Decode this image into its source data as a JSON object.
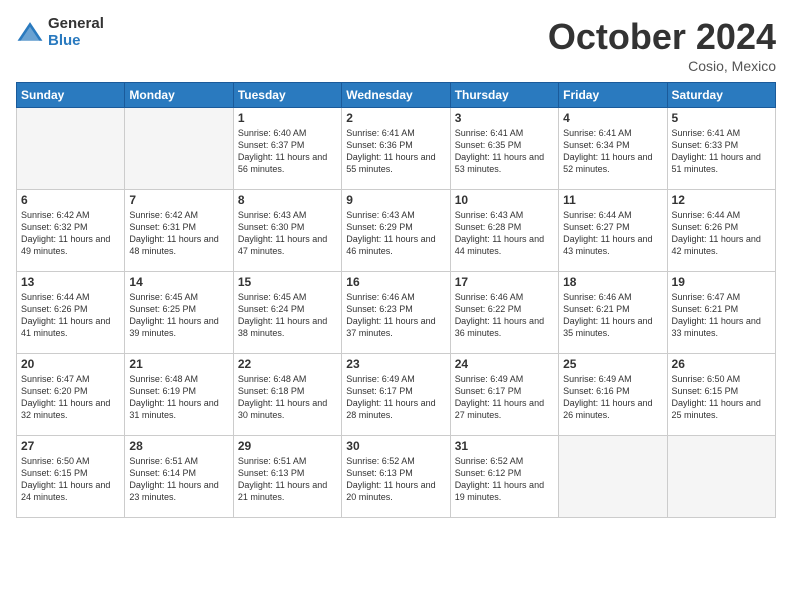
{
  "logo": {
    "general": "General",
    "blue": "Blue"
  },
  "title": "October 2024",
  "location": "Cosio, Mexico",
  "days_of_week": [
    "Sunday",
    "Monday",
    "Tuesday",
    "Wednesday",
    "Thursday",
    "Friday",
    "Saturday"
  ],
  "weeks": [
    [
      {
        "day": "",
        "info": ""
      },
      {
        "day": "",
        "info": ""
      },
      {
        "day": "1",
        "info": "Sunrise: 6:40 AM\nSunset: 6:37 PM\nDaylight: 11 hours and 56 minutes."
      },
      {
        "day": "2",
        "info": "Sunrise: 6:41 AM\nSunset: 6:36 PM\nDaylight: 11 hours and 55 minutes."
      },
      {
        "day": "3",
        "info": "Sunrise: 6:41 AM\nSunset: 6:35 PM\nDaylight: 11 hours and 53 minutes."
      },
      {
        "day": "4",
        "info": "Sunrise: 6:41 AM\nSunset: 6:34 PM\nDaylight: 11 hours and 52 minutes."
      },
      {
        "day": "5",
        "info": "Sunrise: 6:41 AM\nSunset: 6:33 PM\nDaylight: 11 hours and 51 minutes."
      }
    ],
    [
      {
        "day": "6",
        "info": "Sunrise: 6:42 AM\nSunset: 6:32 PM\nDaylight: 11 hours and 49 minutes."
      },
      {
        "day": "7",
        "info": "Sunrise: 6:42 AM\nSunset: 6:31 PM\nDaylight: 11 hours and 48 minutes."
      },
      {
        "day": "8",
        "info": "Sunrise: 6:43 AM\nSunset: 6:30 PM\nDaylight: 11 hours and 47 minutes."
      },
      {
        "day": "9",
        "info": "Sunrise: 6:43 AM\nSunset: 6:29 PM\nDaylight: 11 hours and 46 minutes."
      },
      {
        "day": "10",
        "info": "Sunrise: 6:43 AM\nSunset: 6:28 PM\nDaylight: 11 hours and 44 minutes."
      },
      {
        "day": "11",
        "info": "Sunrise: 6:44 AM\nSunset: 6:27 PM\nDaylight: 11 hours and 43 minutes."
      },
      {
        "day": "12",
        "info": "Sunrise: 6:44 AM\nSunset: 6:26 PM\nDaylight: 11 hours and 42 minutes."
      }
    ],
    [
      {
        "day": "13",
        "info": "Sunrise: 6:44 AM\nSunset: 6:26 PM\nDaylight: 11 hours and 41 minutes."
      },
      {
        "day": "14",
        "info": "Sunrise: 6:45 AM\nSunset: 6:25 PM\nDaylight: 11 hours and 39 minutes."
      },
      {
        "day": "15",
        "info": "Sunrise: 6:45 AM\nSunset: 6:24 PM\nDaylight: 11 hours and 38 minutes."
      },
      {
        "day": "16",
        "info": "Sunrise: 6:46 AM\nSunset: 6:23 PM\nDaylight: 11 hours and 37 minutes."
      },
      {
        "day": "17",
        "info": "Sunrise: 6:46 AM\nSunset: 6:22 PM\nDaylight: 11 hours and 36 minutes."
      },
      {
        "day": "18",
        "info": "Sunrise: 6:46 AM\nSunset: 6:21 PM\nDaylight: 11 hours and 35 minutes."
      },
      {
        "day": "19",
        "info": "Sunrise: 6:47 AM\nSunset: 6:21 PM\nDaylight: 11 hours and 33 minutes."
      }
    ],
    [
      {
        "day": "20",
        "info": "Sunrise: 6:47 AM\nSunset: 6:20 PM\nDaylight: 11 hours and 32 minutes."
      },
      {
        "day": "21",
        "info": "Sunrise: 6:48 AM\nSunset: 6:19 PM\nDaylight: 11 hours and 31 minutes."
      },
      {
        "day": "22",
        "info": "Sunrise: 6:48 AM\nSunset: 6:18 PM\nDaylight: 11 hours and 30 minutes."
      },
      {
        "day": "23",
        "info": "Sunrise: 6:49 AM\nSunset: 6:17 PM\nDaylight: 11 hours and 28 minutes."
      },
      {
        "day": "24",
        "info": "Sunrise: 6:49 AM\nSunset: 6:17 PM\nDaylight: 11 hours and 27 minutes."
      },
      {
        "day": "25",
        "info": "Sunrise: 6:49 AM\nSunset: 6:16 PM\nDaylight: 11 hours and 26 minutes."
      },
      {
        "day": "26",
        "info": "Sunrise: 6:50 AM\nSunset: 6:15 PM\nDaylight: 11 hours and 25 minutes."
      }
    ],
    [
      {
        "day": "27",
        "info": "Sunrise: 6:50 AM\nSunset: 6:15 PM\nDaylight: 11 hours and 24 minutes."
      },
      {
        "day": "28",
        "info": "Sunrise: 6:51 AM\nSunset: 6:14 PM\nDaylight: 11 hours and 23 minutes."
      },
      {
        "day": "29",
        "info": "Sunrise: 6:51 AM\nSunset: 6:13 PM\nDaylight: 11 hours and 21 minutes."
      },
      {
        "day": "30",
        "info": "Sunrise: 6:52 AM\nSunset: 6:13 PM\nDaylight: 11 hours and 20 minutes."
      },
      {
        "day": "31",
        "info": "Sunrise: 6:52 AM\nSunset: 6:12 PM\nDaylight: 11 hours and 19 minutes."
      },
      {
        "day": "",
        "info": ""
      },
      {
        "day": "",
        "info": ""
      }
    ]
  ]
}
